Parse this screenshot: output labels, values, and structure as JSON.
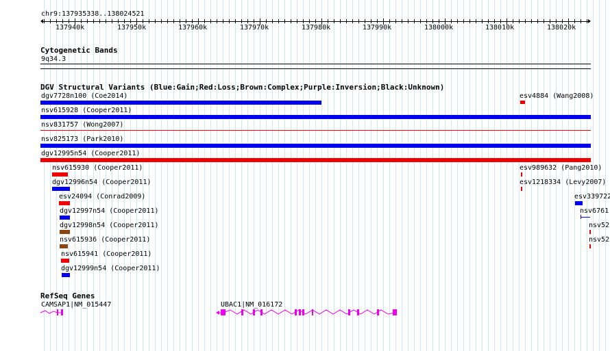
{
  "ruler": {
    "position": "chr9:137935338..138024521",
    "ticks": [
      "137940k",
      "137950k",
      "137960k",
      "137970k",
      "137980k",
      "137990k",
      "138000k",
      "138010k",
      "138020k"
    ]
  },
  "cytoband": {
    "title": "Cytogenetic Bands",
    "band": "9q34.3"
  },
  "dgv": {
    "title": "DGV Structural Variants (Blue:Gain;Red:Loss;Brown:Complex;Purple:Inversion;Black:Unknown)",
    "colors": {
      "gain": "#0000ee",
      "loss": "#ee0000",
      "complex": "#8b4513",
      "unknown": "#000000"
    },
    "variants": [
      "dgv7728n100 (Coe2014)",
      "esv4884 (Wang2008)",
      "nsv615928 (Cooper2011)",
      "nsv831757 (Wong2007)",
      "nsv825173 (Park2010)",
      "dgv12995n54 (Cooper2011)",
      "nsv615930 (Cooper2011)",
      "esv989632 (Pang2010)",
      "dgv12996n54 (Cooper2011)",
      "esv1218334 (Levy2007)",
      "esv24094 (Conrad2009)",
      "esv339722",
      "dgv12997n54 (Cooper2011)",
      "nsv6761",
      "dgv12998n54 (Cooper2011)",
      "nsv52",
      "nsv615936 (Cooper2011)",
      "nsv52",
      "nsv615941 (Cooper2011)",
      "dgv12999n54 (Cooper2011)"
    ]
  },
  "refseq": {
    "title": "RefSeq Genes",
    "color": "#ee00ee",
    "genes": [
      "CAMSAP1|NM_015447",
      "UBAC1|NM_016172"
    ]
  }
}
